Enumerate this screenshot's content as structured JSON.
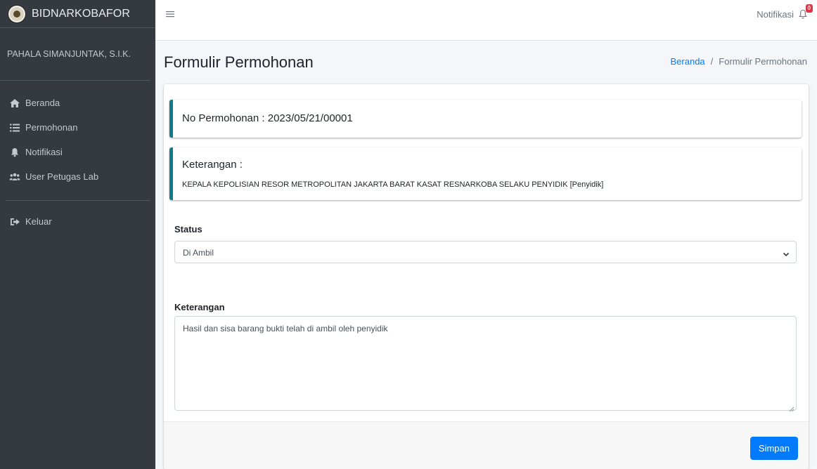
{
  "brand": {
    "name": "BIDNARKOBAFOR"
  },
  "user": {
    "name": "PAHALA SIMANJUNTAK, S.I.K."
  },
  "sidebar": {
    "items": [
      {
        "label": "Beranda",
        "icon": "home-icon"
      },
      {
        "label": "Permohonan",
        "icon": "list-icon"
      },
      {
        "label": "Notifikasi",
        "icon": "bell-icon"
      },
      {
        "label": "User Petugas Lab",
        "icon": "users-icon"
      }
    ],
    "logout": {
      "label": "Keluar",
      "icon": "sign-out-icon"
    }
  },
  "topbar": {
    "notif_label": "Notifikasi",
    "notif_count": "0"
  },
  "page": {
    "title": "Formulir Permohonan",
    "breadcrumb": {
      "home": "Beranda",
      "current": "Formulir Permohonan"
    }
  },
  "form": {
    "no_permohonan": "No Permohonan : 2023/05/21/00001",
    "keterangan_title": "Keterangan :",
    "keterangan_text": "KEPALA KEPOLISIAN RESOR METROPOLITAN JAKARTA BARAT KASAT RESNARKOBA SELAKU PENYIDIK [Penyidik]",
    "status_label": "Status",
    "status_value": "Di Ambil",
    "note_label": "Keterangan",
    "note_value": "Hasil dan sisa barang bukti telah di ambil oleh penyidik",
    "submit_label": "Simpan"
  },
  "colors": {
    "sidebar_bg": "#343a40",
    "accent": "#007bff",
    "callout_border": "#117a8b",
    "badge": "#dc3545"
  }
}
